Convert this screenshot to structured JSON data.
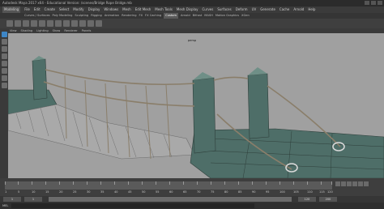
{
  "titlebar": {
    "title": "Autodesk Maya 2017 x64 - Educational Version: /scenes/Bridge Rope Bridge.mb"
  },
  "menubar": {
    "mode": "Modeling",
    "items": [
      "File",
      "Edit",
      "Create",
      "Select",
      "Modify",
      "Display",
      "Windows",
      "Mesh",
      "Edit Mesh",
      "Mesh Tools",
      "Mesh Display",
      "Curves",
      "Surfaces",
      "Deform",
      "UV",
      "Generate",
      "Cache",
      "Arnold",
      "Help"
    ]
  },
  "shelftabs": [
    "Curves / Surfaces",
    "Poly Modeling",
    "Sculpting",
    "Rigging",
    "Animation",
    "Rendering",
    "FX",
    "FX Caching",
    "Custom",
    "Arnold",
    "Bifrost",
    "MASH",
    "Motion Graphics",
    "XGen"
  ],
  "panelmenu": [
    "View",
    "Shading",
    "Lighting",
    "Show",
    "Renderer",
    "Panels"
  ],
  "viewport": {
    "label": "persp"
  },
  "timeline": {
    "ticks": [
      "1",
      "5",
      "10",
      "15",
      "20",
      "25",
      "30",
      "35",
      "40",
      "45",
      "50",
      "55",
      "60",
      "65",
      "70",
      "75",
      "80",
      "85",
      "90",
      "95",
      "100",
      "105",
      "110",
      "115",
      "120"
    ]
  },
  "range": {
    "start": "1",
    "start_inner": "1",
    "end_inner": "120",
    "end": "200"
  },
  "cmdline": {
    "lang": "MEL"
  },
  "colors": {
    "viewport_bg": "#a0a0a0",
    "stone": "#4e6e68",
    "wood": "#a9a9a9",
    "rope": "#8a7e6a",
    "selection": "#3e86c6"
  }
}
